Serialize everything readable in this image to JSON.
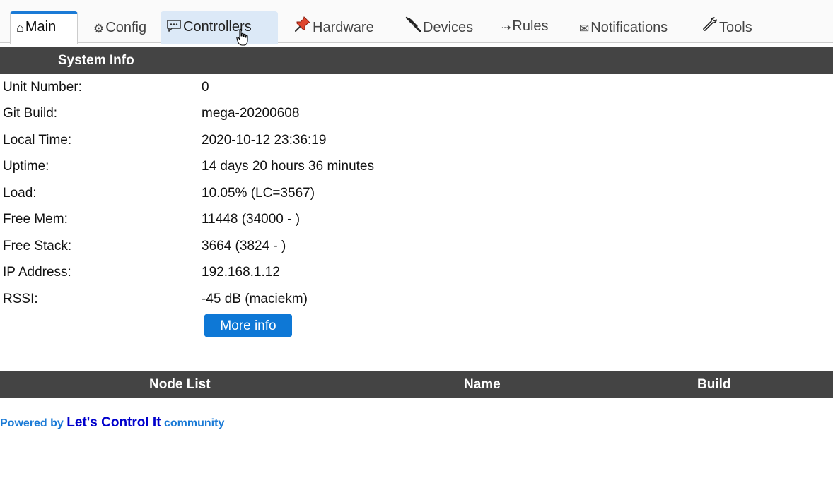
{
  "tabs": [
    {
      "icon": "⌂",
      "label": "Main",
      "icon_name": "home-icon"
    },
    {
      "icon": "⚙",
      "label": "Config",
      "icon_name": "gear-icon"
    },
    {
      "icon": "",
      "label": "Controllers",
      "icon_name": "speech-bubble-icon"
    },
    {
      "icon": "",
      "label": "Hardware",
      "icon_name": "pushpin-icon"
    },
    {
      "icon": "",
      "label": "Devices",
      "icon_name": "plug-icon"
    },
    {
      "icon": "⇢",
      "label": "Rules",
      "icon_name": "arrow-right-icon"
    },
    {
      "icon": "✉",
      "label": "Notifications",
      "icon_name": "envelope-icon"
    },
    {
      "icon": "",
      "label": "Tools",
      "icon_name": "wrench-icon"
    }
  ],
  "system_info": {
    "header": "System Info",
    "rows": [
      {
        "label": "Unit Number:",
        "value": "0"
      },
      {
        "label": "Git Build:",
        "value": "mega-20200608"
      },
      {
        "label": "Local Time:",
        "value": "2020-10-12 23:36:19"
      },
      {
        "label": "Uptime:",
        "value": "14 days 20 hours 36 minutes"
      },
      {
        "label": "Load:",
        "value": "10.05% (LC=3567)"
      },
      {
        "label": "Free Mem:",
        "value": "11448 (34000 - )"
      },
      {
        "label": "Free Stack:",
        "value": "3664 (3824 - )"
      },
      {
        "label": "IP Address:",
        "value": "192.168.1.12"
      },
      {
        "label": "RSSI:",
        "value": "-45 dB (maciekm)"
      }
    ],
    "more_info_label": "More info"
  },
  "node_list": {
    "col_node": "Node List",
    "col_name": "Name",
    "col_build": "Build"
  },
  "footer": {
    "prefix": "Powered by ",
    "brand": "Let's Control It",
    "suffix": " community"
  },
  "colors": {
    "accent": "#1a7ad6",
    "header_bg": "#444444",
    "button_bg": "#0e78d6",
    "tab_hover_bg": "#dce9f7"
  }
}
